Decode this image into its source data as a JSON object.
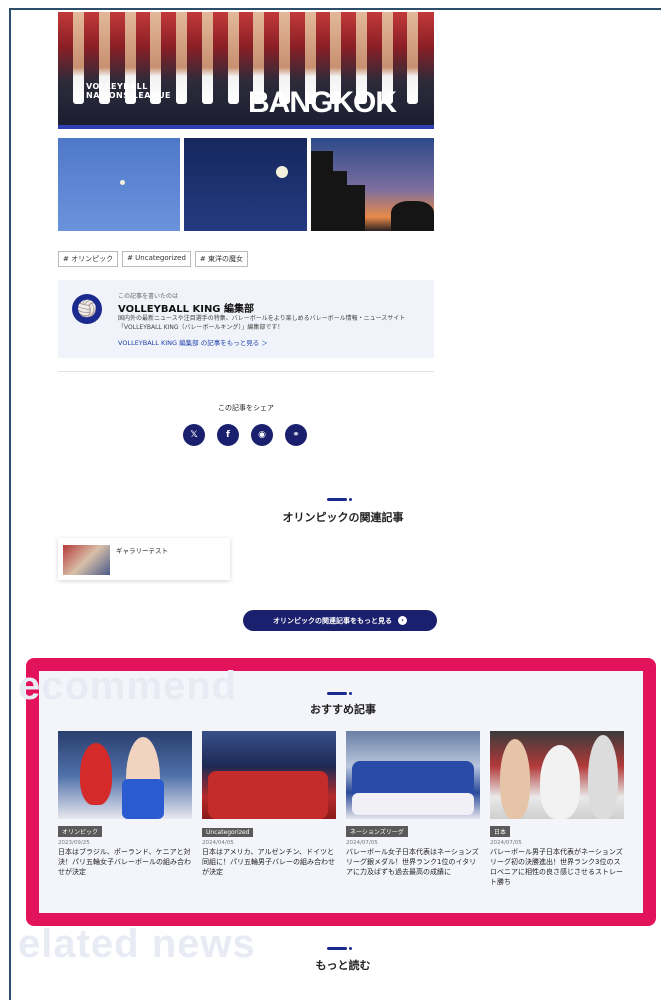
{
  "hero": {
    "logo_text": "VOLLEYBALL\nNATIONS LEAGUE",
    "city_text": "BANGKOK"
  },
  "tags": [
    "# オリンピック",
    "# Uncategorized",
    "# 東洋の魔女"
  ],
  "author": {
    "kicker": "この記事を書いたのは",
    "name": "VOLLEYBALL KING 編集部",
    "description": "国内外の最新ニュースや注目選手の特集、バレーボールをより楽しめるバレーボール情報・ニュースサイト「VOLLEYBALL KING（バレーボールキング）」編集部です！",
    "more_link": "VOLLEYBALL KING 編集部 の記事をもっと見る ＞"
  },
  "share": {
    "label": "この記事をシェア",
    "buttons": [
      {
        "icon": "x-icon",
        "glyph": "𝕏"
      },
      {
        "icon": "facebook-icon",
        "glyph": "f"
      },
      {
        "icon": "line-icon",
        "glyph": "◉"
      },
      {
        "icon": "link-icon",
        "glyph": "⚭"
      }
    ]
  },
  "related": {
    "title": "オリンピックの関連記事",
    "cards": [
      {
        "title": "ギャラリーテスト"
      }
    ],
    "more_button": "オリンピックの関連記事をもっと見る"
  },
  "recommend": {
    "bg_word": "ecommend",
    "title": "おすすめ記事",
    "cards": [
      {
        "category": "オリンピック",
        "date": "2023/09/25",
        "title": "日本はブラジル、ポーランド、ケニアと対決！パリ五輪女子バレーボールの組み合わせが決定"
      },
      {
        "category": "Uncategorized",
        "date": "2024/04/05",
        "title": "日本はアメリカ、アルゼンチン、ドイツと同組に！パリ五輪男子バレーの組み合わせが決定"
      },
      {
        "category": "ネーションズリーグ",
        "date": "2024/07/05",
        "title": "バレーボール女子日本代表はネーションズリーグ銀メダル！世界ランク1位のイタリアに力及ばずも過去最高の成績に"
      },
      {
        "category": "日本",
        "date": "2024/07/05",
        "title": "バレーボール男子日本代表がネーションズリーグ初の決勝進出！世界ランク3位のスロベニアに相性の良さ感じさせるストレート勝ち"
      }
    ]
  },
  "more": {
    "bg_word": "elated news",
    "title": "もっと読む"
  },
  "colors": {
    "navy": "#1a1f6e",
    "highlight": "#e3135b"
  }
}
